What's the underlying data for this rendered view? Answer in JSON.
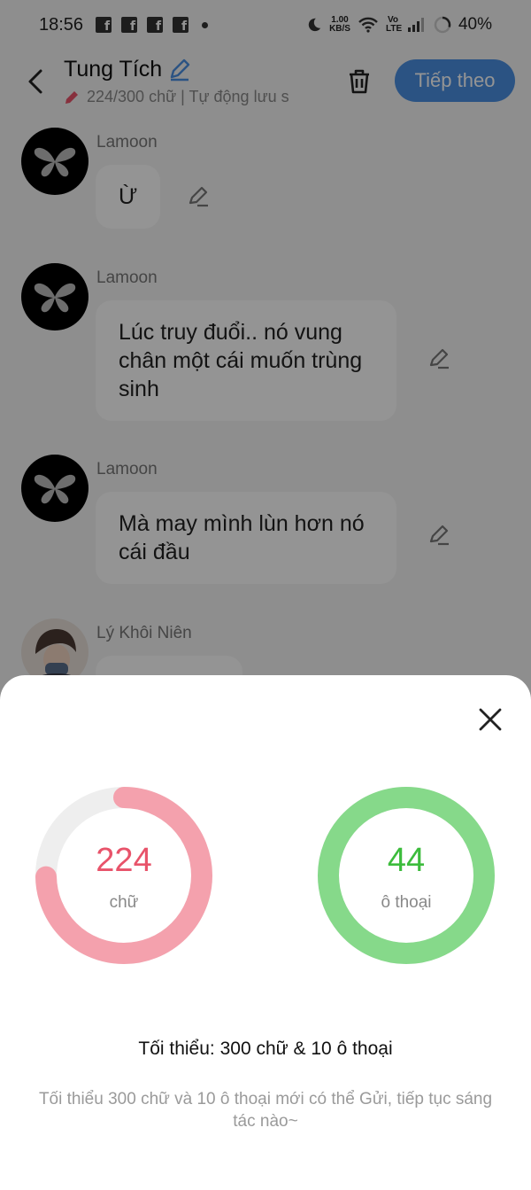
{
  "status_bar": {
    "time": "18:56",
    "net_speed_value": "1.00",
    "net_speed_unit": "KB/S",
    "volte": "Vo LTE",
    "battery": "40%"
  },
  "header": {
    "title": "Tung Tích",
    "subtitle": "224/300 chữ | Tự động lưu s",
    "next_label": "Tiếp theo",
    "accent_color": "#4a90e2"
  },
  "messages": [
    {
      "name": "Lamoon",
      "text": "Ừ",
      "avatar": "butterfly"
    },
    {
      "name": "Lamoon",
      "text": "Lúc truy đuổi.. nó vung chân một cái muốn trùng sinh",
      "avatar": "butterfly"
    },
    {
      "name": "Lamoon",
      "text": "Mà may mình lùn hơn nó cái đầu",
      "avatar": "butterfly"
    },
    {
      "name": "Lý Khôi Niên",
      "text": "",
      "avatar": "person"
    }
  ],
  "sheet": {
    "words": {
      "value": "224",
      "unit": "chữ",
      "progress": 0.7467,
      "color": "#f4a1ad",
      "text_color": "#e8536a"
    },
    "dialogs": {
      "value": "44",
      "unit": "ô thoại",
      "progress": 1.0,
      "color": "#86d98a",
      "text_color": "#3cbc3c"
    },
    "min_title": "Tối thiểu: 300 chữ & 10 ô thoại",
    "min_desc": "Tối thiểu 300 chữ và 10 ô thoại mới có thể Gửi, tiếp tục sáng tác nào~"
  }
}
